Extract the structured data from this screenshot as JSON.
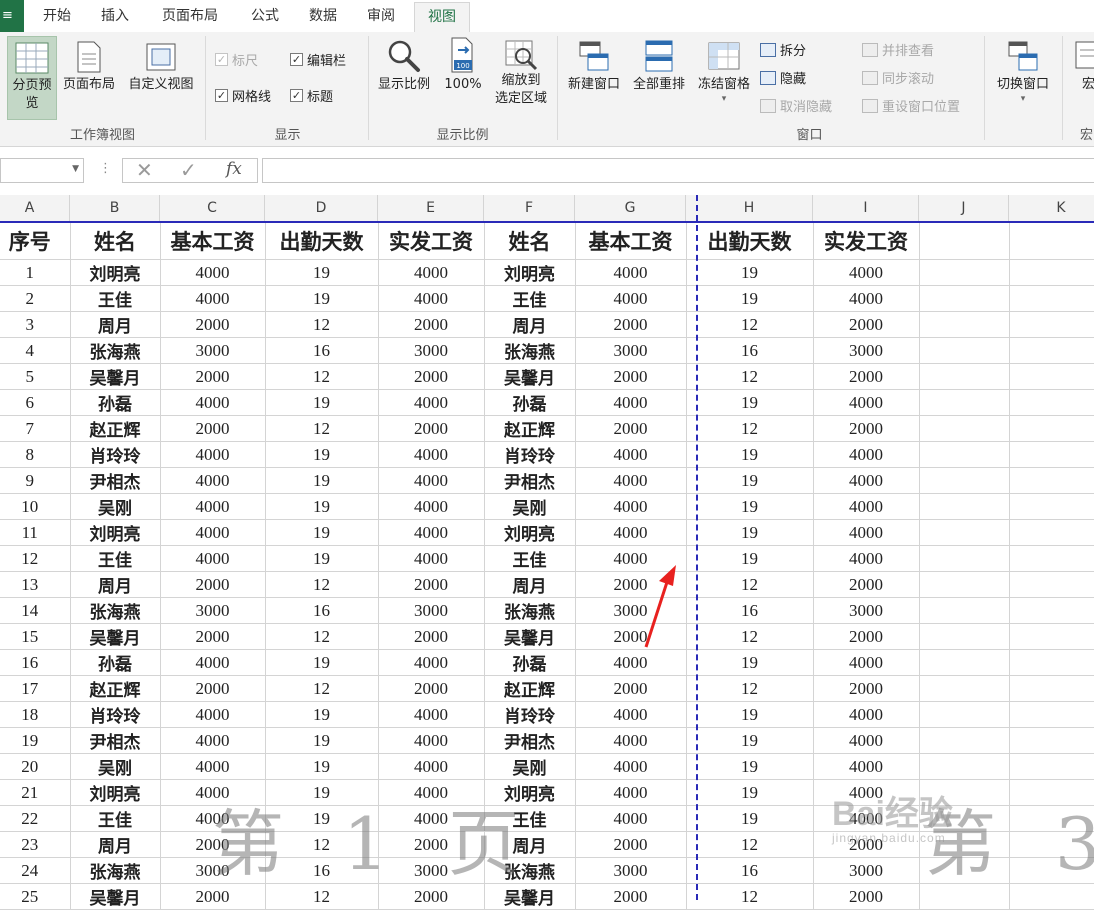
{
  "tabs": {
    "file_label": "≡",
    "items": [
      {
        "label": "开始"
      },
      {
        "label": "插入"
      },
      {
        "label": "页面布局"
      },
      {
        "label": "公式"
      },
      {
        "label": "数据"
      },
      {
        "label": "审阅"
      },
      {
        "label": "视图"
      }
    ],
    "active": "视图"
  },
  "ribbon": {
    "workbook_views": {
      "group_label": "工作簿视图",
      "page_break_preview": "分页预览",
      "page_layout": "页面布局",
      "custom_views": "自定义视图"
    },
    "show": {
      "group_label": "显示",
      "ruler": "标尺",
      "formula_bar": "编辑栏",
      "gridlines": "网格线",
      "headings": "标题"
    },
    "zoom": {
      "group_label": "显示比例",
      "zoom": "显示比例",
      "zoom_100": "100%",
      "zoom_to_selection_line1": "缩放到",
      "zoom_to_selection_line2": "选定区域",
      "icon_100": "100"
    },
    "window": {
      "group_label": "窗口",
      "new_window": "新建窗口",
      "arrange_all": "全部重排",
      "freeze_panes": "冻结窗格",
      "split": "拆分",
      "hide": "隐藏",
      "unhide": "取消隐藏",
      "view_side_by_side": "并排查看",
      "sync_scroll": "同步滚动",
      "reset_window_position": "重设窗口位置",
      "switch_windows": "切换窗口"
    },
    "macros": {
      "label": "宏",
      "group_label": "宏"
    }
  },
  "formula_bar": {
    "cancel": "✕",
    "enter": "✓",
    "fx": "fx",
    "value": ""
  },
  "columns": [
    "A",
    "B",
    "C",
    "D",
    "E",
    "F",
    "G",
    "H",
    "I",
    "J",
    "K"
  ],
  "header_row": [
    "序号",
    "姓名",
    "基本工资",
    "出勤天数",
    "实发工资",
    "姓名",
    "基本工资",
    "出勤天数",
    "实发工资"
  ],
  "rows": [
    [
      "1",
      "刘明亮",
      "4000",
      "19",
      "4000",
      "刘明亮",
      "4000",
      "19",
      "4000"
    ],
    [
      "2",
      "王佳",
      "4000",
      "19",
      "4000",
      "王佳",
      "4000",
      "19",
      "4000"
    ],
    [
      "3",
      "周月",
      "2000",
      "12",
      "2000",
      "周月",
      "2000",
      "12",
      "2000"
    ],
    [
      "4",
      "张海燕",
      "3000",
      "16",
      "3000",
      "张海燕",
      "3000",
      "16",
      "3000"
    ],
    [
      "5",
      "吴馨月",
      "2000",
      "12",
      "2000",
      "吴馨月",
      "2000",
      "12",
      "2000"
    ],
    [
      "6",
      "孙磊",
      "4000",
      "19",
      "4000",
      "孙磊",
      "4000",
      "19",
      "4000"
    ],
    [
      "7",
      "赵正辉",
      "2000",
      "12",
      "2000",
      "赵正辉",
      "2000",
      "12",
      "2000"
    ],
    [
      "8",
      "肖玲玲",
      "4000",
      "19",
      "4000",
      "肖玲玲",
      "4000",
      "19",
      "4000"
    ],
    [
      "9",
      "尹相杰",
      "4000",
      "19",
      "4000",
      "尹相杰",
      "4000",
      "19",
      "4000"
    ],
    [
      "10",
      "吴刚",
      "4000",
      "19",
      "4000",
      "吴刚",
      "4000",
      "19",
      "4000"
    ],
    [
      "11",
      "刘明亮",
      "4000",
      "19",
      "4000",
      "刘明亮",
      "4000",
      "19",
      "4000"
    ],
    [
      "12",
      "王佳",
      "4000",
      "19",
      "4000",
      "王佳",
      "4000",
      "19",
      "4000"
    ],
    [
      "13",
      "周月",
      "2000",
      "12",
      "2000",
      "周月",
      "2000",
      "12",
      "2000"
    ],
    [
      "14",
      "张海燕",
      "3000",
      "16",
      "3000",
      "张海燕",
      "3000",
      "16",
      "3000"
    ],
    [
      "15",
      "吴馨月",
      "2000",
      "12",
      "2000",
      "吴馨月",
      "2000",
      "12",
      "2000"
    ],
    [
      "16",
      "孙磊",
      "4000",
      "19",
      "4000",
      "孙磊",
      "4000",
      "19",
      "4000"
    ],
    [
      "17",
      "赵正辉",
      "2000",
      "12",
      "2000",
      "赵正辉",
      "2000",
      "12",
      "2000"
    ],
    [
      "18",
      "肖玲玲",
      "4000",
      "19",
      "4000",
      "肖玲玲",
      "4000",
      "19",
      "4000"
    ],
    [
      "19",
      "尹相杰",
      "4000",
      "19",
      "4000",
      "尹相杰",
      "4000",
      "19",
      "4000"
    ],
    [
      "20",
      "吴刚",
      "4000",
      "19",
      "4000",
      "吴刚",
      "4000",
      "19",
      "4000"
    ],
    [
      "21",
      "刘明亮",
      "4000",
      "19",
      "4000",
      "刘明亮",
      "4000",
      "19",
      "4000"
    ],
    [
      "22",
      "王佳",
      "4000",
      "19",
      "4000",
      "王佳",
      "4000",
      "19",
      "4000"
    ],
    [
      "23",
      "周月",
      "2000",
      "12",
      "2000",
      "周月",
      "2000",
      "12",
      "2000"
    ],
    [
      "24",
      "张海燕",
      "3000",
      "16",
      "3000",
      "张海燕",
      "3000",
      "16",
      "3000"
    ],
    [
      "25",
      "吴馨月",
      "2000",
      "12",
      "2000",
      "吴馨月",
      "2000",
      "12",
      "2000"
    ]
  ],
  "watermarks": {
    "page1": "第 1 页",
    "page3": "第 3"
  },
  "baidu_watermark": {
    "text": "Bai经验",
    "sub": "jingyan.baidu.com"
  },
  "colors": {
    "excel_green": "#217346",
    "page_break_blue": "#2a2ab8",
    "arrow_red": "#e8211f"
  }
}
